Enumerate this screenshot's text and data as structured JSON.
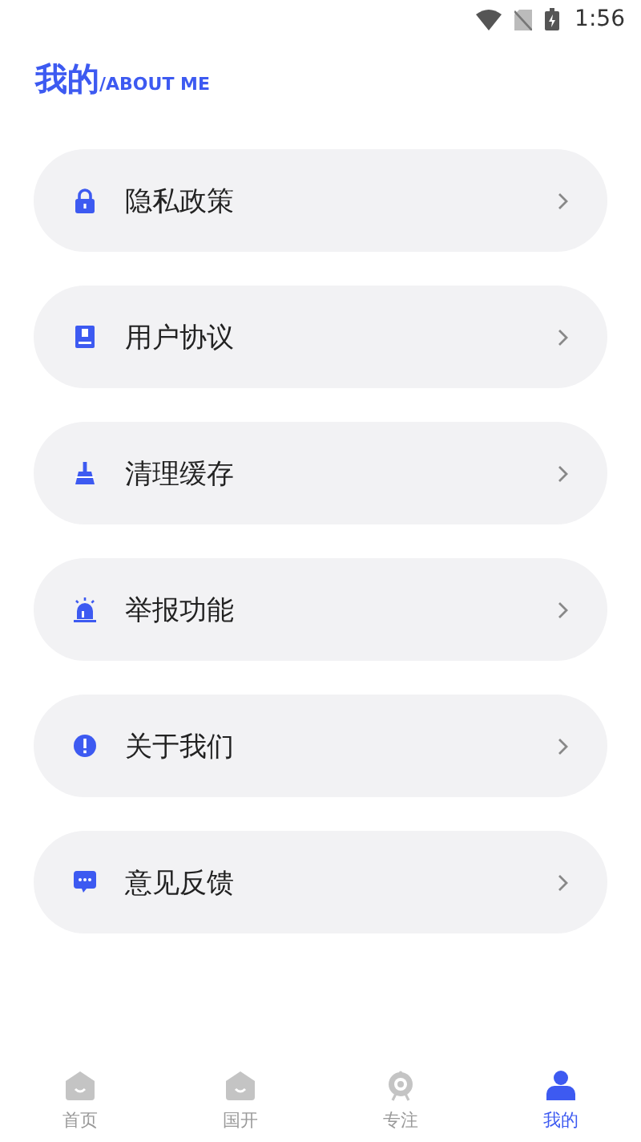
{
  "status_bar": {
    "time": "1:56"
  },
  "header": {
    "title": "我的",
    "subtitle": "/ABOUT ME"
  },
  "menu": [
    {
      "label": "隐私政策"
    },
    {
      "label": "用户协议"
    },
    {
      "label": "清理缓存"
    },
    {
      "label": "举报功能"
    },
    {
      "label": "关于我们"
    },
    {
      "label": "意见反馈"
    }
  ],
  "tabs": [
    {
      "label": "首页",
      "selected": false
    },
    {
      "label": "国开",
      "selected": false
    },
    {
      "label": "专注",
      "selected": false
    },
    {
      "label": "我的",
      "selected": true
    }
  ]
}
